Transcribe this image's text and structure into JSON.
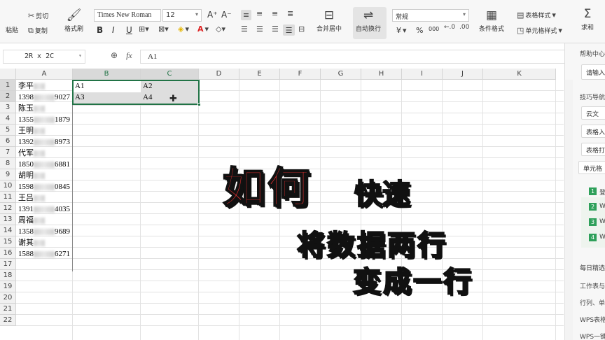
{
  "ribbon": {
    "paste_label": "粘贴",
    "cut_label": "剪切",
    "copy_label": "复制",
    "format_painter_label": "格式刷",
    "font_name": "Times New Roman",
    "font_size": "12",
    "bold": "B",
    "italic": "I",
    "underline": "U",
    "merge_center_label": "合并居中",
    "auto_wrap_label": "自动换行",
    "number_format": "常规",
    "currency_symbol": "¥",
    "percent_symbol": "%",
    "thousands_symbol": "000",
    "conditional_format_label": "条件格式",
    "table_style_label": "表格样式",
    "cell_style_label": "单元格样式",
    "sum_label": "求和",
    "sum_symbol": "Σ"
  },
  "formula_bar": {
    "name_box": "2R x 2C",
    "zoom_icon": "⊕",
    "fx_label": "fx",
    "content": "A1"
  },
  "grid": {
    "columns": [
      "A",
      "B",
      "C",
      "D",
      "E",
      "F",
      "G",
      "H",
      "I",
      "J",
      "K"
    ],
    "rows": [
      "1",
      "2",
      "3",
      "4",
      "5",
      "6",
      "7",
      "8",
      "9",
      "10",
      "11",
      "12",
      "13",
      "14",
      "15",
      "16",
      "17",
      "18",
      "19",
      "20",
      "21",
      "22"
    ],
    "col_a": [
      {
        "pre": "李平",
        "post": ""
      },
      {
        "pre": "1398",
        "post": "9027"
      },
      {
        "pre": "陈玉",
        "post": ""
      },
      {
        "pre": "1355",
        "post": "1879"
      },
      {
        "pre": "王明",
        "post": ""
      },
      {
        "pre": "1392",
        "post": "8973"
      },
      {
        "pre": "代军",
        "post": ""
      },
      {
        "pre": "1850",
        "post": "6881"
      },
      {
        "pre": "胡明",
        "post": ""
      },
      {
        "pre": "1598",
        "post": "0845"
      },
      {
        "pre": "王吕",
        "post": ""
      },
      {
        "pre": "1391",
        "post": "4035"
      },
      {
        "pre": "周福",
        "post": ""
      },
      {
        "pre": "1358",
        "post": "9689"
      },
      {
        "pre": "谢其",
        "post": ""
      },
      {
        "pre": "1588",
        "post": "6271"
      }
    ],
    "b1": "A1",
    "c1": "A2",
    "b2": "A3",
    "c2": "A4"
  },
  "right_panel": {
    "help_center": "帮助中心",
    "input_placeholder": "请输入",
    "skills_nav": "技巧导航",
    "btn1": "云文",
    "btn2": "表格入",
    "btn3": "表格打",
    "btn4": "单元格",
    "items": [
      "1",
      "2",
      "3",
      "4"
    ],
    "item_texts": [
      "登",
      "W",
      "W",
      "W"
    ],
    "daily": "每日精选",
    "t1": "工作表与",
    "t2": "行列、单",
    "t3": "WPS表格",
    "t4": "WPS一键"
  },
  "overlay": {
    "line1_a": "如何",
    "line1_b": "快速",
    "line2": "将数据两行",
    "line3": "变成一行"
  }
}
